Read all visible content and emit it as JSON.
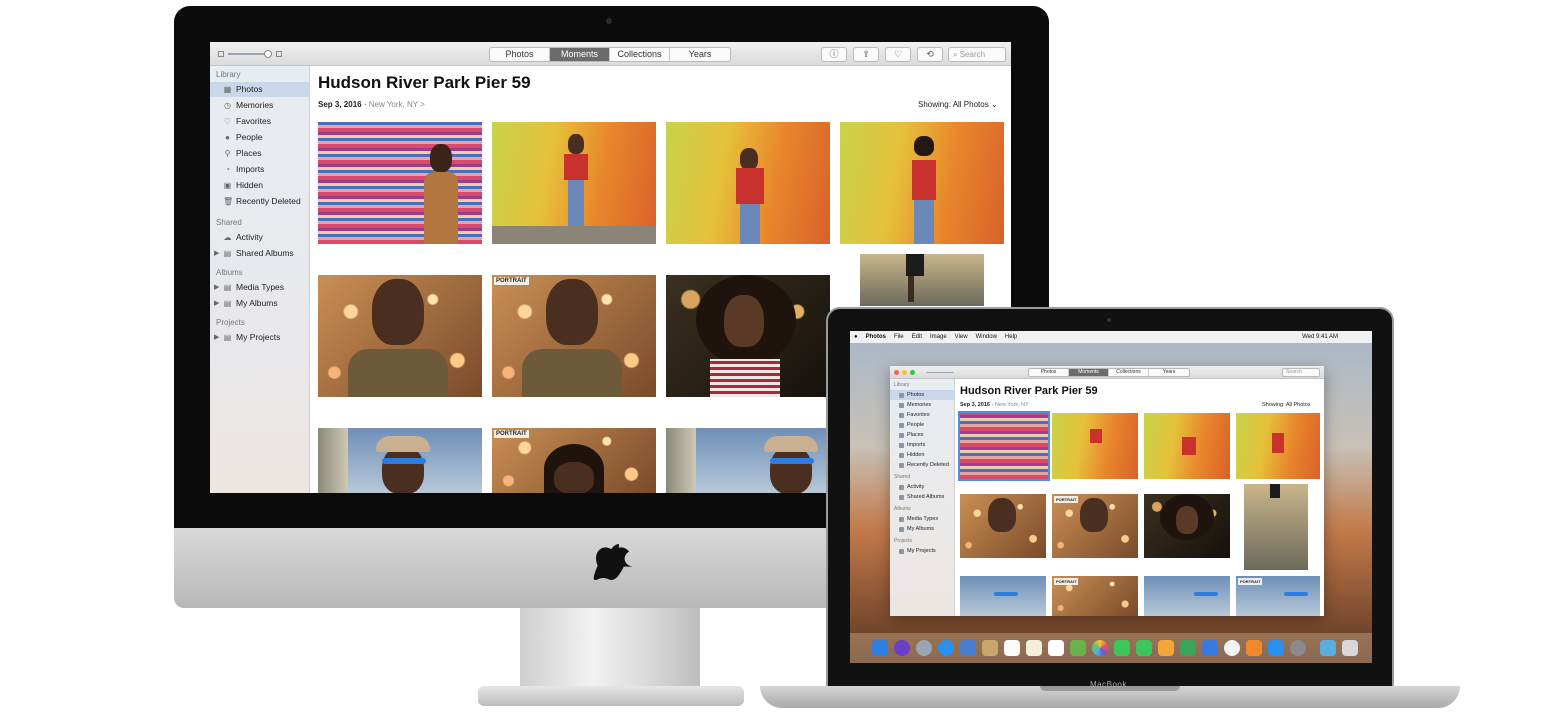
{
  "imac": {
    "toolbar": {
      "tabs": [
        "Photos",
        "Moments",
        "Collections",
        "Years"
      ],
      "active_tab": "Moments",
      "search_placeholder": "Search"
    },
    "sidebar": {
      "sections": [
        {
          "heading": "Library",
          "items": [
            "Photos",
            "Memories",
            "Favorites",
            "People",
            "Places",
            "Imports",
            "Hidden",
            "Recently Deleted"
          ]
        },
        {
          "heading": "Shared",
          "items": [
            "Activity",
            "Shared Albums"
          ]
        },
        {
          "heading": "Albums",
          "items": [
            "Media Types",
            "My Albums"
          ]
        },
        {
          "heading": "Projects",
          "items": [
            "My Projects"
          ]
        }
      ],
      "selected": "Photos"
    },
    "main": {
      "title": "Hudson River Park Pier 59",
      "date": "Sep 3, 2016",
      "location": "New York, NY",
      "location_chevron": ">",
      "showing": "Showing: All Photos",
      "portrait_badge": "PORTRAIT"
    }
  },
  "macbook": {
    "label": "MacBook",
    "menubar": {
      "items": [
        "Photos",
        "File",
        "Edit",
        "Image",
        "View",
        "Window",
        "Help"
      ],
      "clock": "Wed 9:41 AM"
    },
    "toolbar": {
      "tabs": [
        "Photos",
        "Moments",
        "Collections",
        "Years"
      ],
      "active_tab": "Moments",
      "search_placeholder": "Search"
    },
    "sidebar": {
      "sections": [
        {
          "heading": "Library",
          "items": [
            "Photos",
            "Memories",
            "Favorites",
            "People",
            "Places",
            "Imports",
            "Hidden",
            "Recently Deleted"
          ]
        },
        {
          "heading": "Shared",
          "items": [
            "Activity",
            "Shared Albums"
          ]
        },
        {
          "heading": "Albums",
          "items": [
            "Media Types",
            "My Albums"
          ]
        },
        {
          "heading": "Projects",
          "items": [
            "My Projects"
          ]
        }
      ]
    },
    "main": {
      "title": "Hudson River Park Pier 59",
      "date": "Sep 3, 2016",
      "location": "New York, NY",
      "showing": "Showing: All Photos",
      "portrait_badge": "PORTRAIT"
    }
  },
  "colors": {
    "sidebar_selected": "#c9d7e8",
    "active_tab": "#6b6b6b",
    "traffic_red": "#ff5f57",
    "traffic_yellow": "#febc2e",
    "traffic_green": "#28c840"
  }
}
